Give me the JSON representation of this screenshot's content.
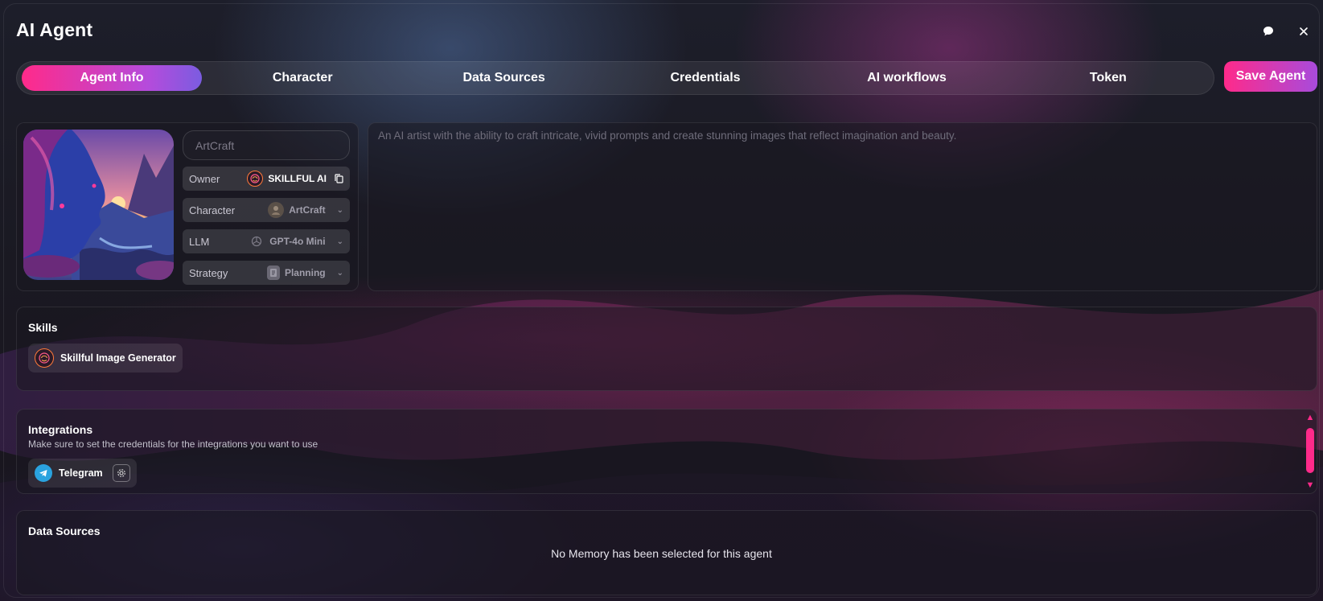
{
  "window": {
    "title": "AI Agent"
  },
  "tabs": [
    {
      "label": "Agent Info",
      "active": true
    },
    {
      "label": "Character",
      "active": false
    },
    {
      "label": "Data Sources",
      "active": false
    },
    {
      "label": "Credentials",
      "active": false
    },
    {
      "label": "AI workflows",
      "active": false
    },
    {
      "label": "Token",
      "active": false
    }
  ],
  "actions": {
    "save_label": "Save Agent"
  },
  "agent": {
    "name_placeholder": "ArtCraft",
    "owner": {
      "label": "Owner",
      "value": "SKILLFUL AI"
    },
    "character": {
      "label": "Character",
      "value": "ArtCraft"
    },
    "llm": {
      "label": "LLM",
      "value": "GPT-4o Mini"
    },
    "strategy": {
      "label": "Strategy",
      "value": "Planning"
    },
    "description": "An AI artist with the ability to craft intricate, vivid prompts and create stunning images that reflect imagination and beauty."
  },
  "skills": {
    "title": "Skills",
    "items": [
      {
        "label": "Skillful Image Generator",
        "icon": "brain-icon"
      }
    ]
  },
  "integrations": {
    "title": "Integrations",
    "subtitle": "Make sure to set the credentials for the integrations you want to use",
    "items": [
      {
        "label": "Telegram",
        "icon": "telegram-icon"
      }
    ]
  },
  "data_sources": {
    "title": "Data Sources",
    "empty_message": "No Memory has been selected for this agent"
  },
  "colors": {
    "accent": "#ff2a8a",
    "accent_end": "#7b5ce0",
    "telegram": "#2aa3df"
  }
}
